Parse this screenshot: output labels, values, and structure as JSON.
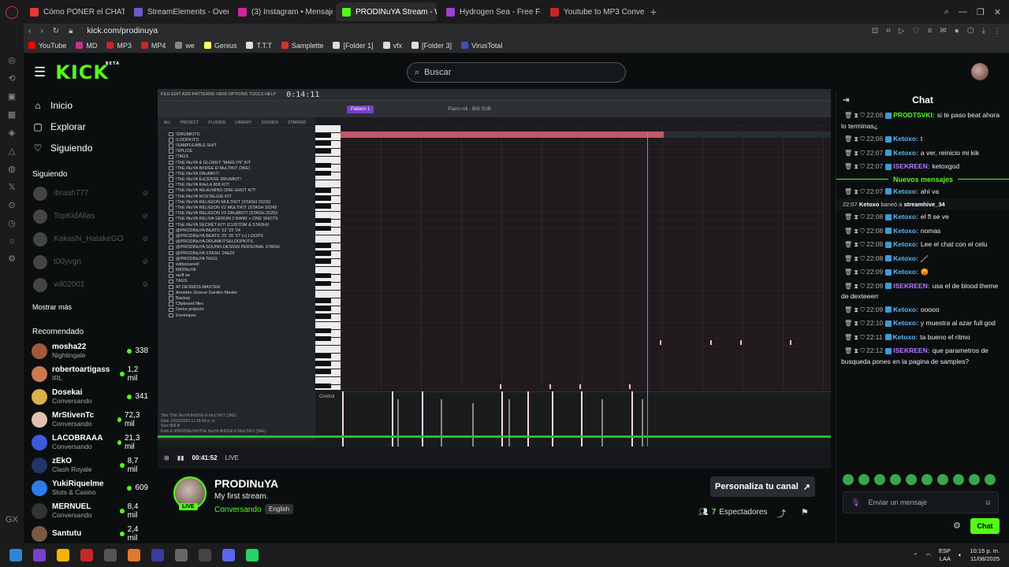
{
  "browser_tabs": [
    {
      "label": "Cómo PONER el CHAT de",
      "color": "#e53935",
      "active": false
    },
    {
      "label": "StreamElements - Overla",
      "color": "#6a5acd",
      "active": false
    },
    {
      "label": "(3) Instagram • Mensajes",
      "color": "#d6249f",
      "active": false
    },
    {
      "label": "PRODINuYA Stream - Wa",
      "color": "#53fc18",
      "active": true
    },
    {
      "label": "Hydrogen Sea - Free Falli",
      "color": "#a040d0",
      "active": false
    },
    {
      "label": "Youtube to MP3 Converte",
      "color": "#c62828",
      "active": false
    }
  ],
  "address": {
    "url": "kick.com/prodinuya"
  },
  "bookmarks": [
    {
      "label": "YouTube",
      "color": "#ff0000"
    },
    {
      "label": "MD",
      "color": "#c13584"
    },
    {
      "label": "MP3",
      "color": "#c62828"
    },
    {
      "label": "MP4",
      "color": "#c62828"
    },
    {
      "label": "we",
      "color": "#888888"
    },
    {
      "label": "Genius",
      "color": "#ffff64"
    },
    {
      "label": "T.T.T",
      "color": "#dddddd"
    },
    {
      "label": "Samplette",
      "color": "#cc3333"
    },
    {
      "label": "[Folder 1]",
      "color": "#dddddd"
    },
    {
      "label": "vfx",
      "color": "#dddddd"
    },
    {
      "label": "[Folder 3]",
      "color": "#dddddd"
    },
    {
      "label": "VirusTotal",
      "color": "#3f51b5"
    }
  ],
  "header": {
    "search_placeholder": "Buscar"
  },
  "sidebar": {
    "nav": [
      {
        "label": "Inicio",
        "icon": "home-icon"
      },
      {
        "label": "Explorar",
        "icon": "compass-icon"
      },
      {
        "label": "Siguiendo",
        "icon": "heart-icon"
      }
    ],
    "following_title": "Siguiendo",
    "following": [
      "ibraah777",
      "TopKidAlias",
      "Kakashi_HatakeGO",
      "t00yvgn",
      "wil02001"
    ],
    "more_label": "Mostrar más",
    "recommended_title": "Recomendado",
    "recommended": [
      {
        "name": "mosha22",
        "category": "Nightingale",
        "viewers": "338",
        "color": "#a05a3c"
      },
      {
        "name": "robertoartigass",
        "category": "IRL",
        "viewers": "1,2 mil",
        "color": "#c97a50"
      },
      {
        "name": "Dosekai",
        "category": "Conversando",
        "viewers": "341",
        "color": "#d9b24c"
      },
      {
        "name": "MrStivenTc",
        "category": "Conversando",
        "viewers": "72,3 mil",
        "color": "#e0c0b0"
      },
      {
        "name": "LACOBRAAA",
        "category": "Conversando",
        "viewers": "21,3 mil",
        "color": "#3b5bdb"
      },
      {
        "name": "zEkO",
        "category": "Clash Royale",
        "viewers": "8,7 mil",
        "color": "#223366"
      },
      {
        "name": "YukiRiquelme",
        "category": "Slots & Casino",
        "viewers": "609",
        "color": "#2b7de9"
      },
      {
        "name": "MERNUEL",
        "category": "Conversando",
        "viewers": "8,4 mil",
        "color": "#333333"
      },
      {
        "name": "Santutu",
        "category": "",
        "viewers": "2,4 mil",
        "color": "#7a5a40"
      }
    ]
  },
  "player": {
    "time": "0:14:11",
    "menu": "FILE EDIT ADD PATTERNS VIEW OPTIONS TOOLS HELP",
    "pattern": "Pattern 1",
    "roll_title": "Piano roll - 808 SUB",
    "control_label": "Control",
    "browser_tabs": [
      "ALL",
      "PROJECT",
      "PLUGINS",
      "LIBRARY",
      "SOUNDS",
      "STARRED"
    ],
    "browser_items": [
      "!DRUMKITS",
      "!LOOPKITS",
      "!SAMPLEABLE SHIT",
      "!SPLICE",
      "!TAGS",
      "!ThE iNuYA & GLOKEY \"MARLYN\" KIT",
      "!ThE iNuYA BrIDGE Ð MuLTiKiT (3KE)",
      "!ThE iNuYA DRuMKIT!",
      "!ThE iNuYA EsCENSE DRUMKIT!",
      "!ThE iNuYA KAvLA 808 KIT!",
      "!ThE iNuYA NEvErMIND ONE-SHOT KIT!",
      "!ThE iNuYA NOSTALGIE KIT",
      "!ThE iNuYA RELIGION MULTIKIT (STASH 2023)!",
      "!ThE iNuYA RELIGION V2 MULTIKIT (STASH 2024)!",
      "!ThE iNuYA RELIGION V3 DRuMKIT! (STASH 2025)!",
      "!ThE iNuYA RELIVA SERUM 2 BANK + ONE SHOTS",
      "!ThE iNuYA SECRET KIT! (CUSTOM & STASH)!",
      "@PRODINuYA BEATS '22 '23 '24",
      "@PRODINuYA BEATS '25 '26 '27 (+) LOOPS",
      "@PRODINuYA DRUMKITS&LOOPKITS",
      "@PRODINuYA SOUND-DESIGN PERSONAL STASH",
      "@PRODINuYA STASH '24&25",
      "@PRODINuYA TAGS",
      "eddyscared!",
      "MIDINuYA",
      "stuff ne",
      "TAGS",
      "AT DESMOS MASTER",
      "Aresden Groove Garden Master",
      "Backup",
      "Clipboard files",
      "Demo projects",
      "Envelopes"
    ],
    "file_info": [
      "Title   !ThE iNuYA BrIDGE Ð MuLTiKiT (3KE)",
      "Date    12/02/2023 11:18:48 p. m.",
      "Size    856 B",
      "Path    E:\\PRODINuYA\\!ThE iNuYA BrIDGE Ð MuLTiKiT (3KE)"
    ],
    "os_time": "00:41:52",
    "os_live": "LIVE"
  },
  "channel": {
    "name": "PRODINuYA",
    "title": "My first stream.",
    "category": "Conversando",
    "language": "English",
    "live_label": "LIVE",
    "customize_label": "Personaliza tu canal",
    "viewers_count": "7",
    "viewers_label": "Espectadores"
  },
  "chat": {
    "title": "Chat",
    "new_messages_label": "Nuevos mensajes",
    "messages_before": [
      {
        "time": "22:06",
        "user": "PRODTSVKI",
        "color": "#53fc18",
        "text": "si te paso beat ahora lo terminas¿"
      },
      {
        "time": "22:06",
        "user": "Ketoxo",
        "color": "#5db8f0",
        "text": "t"
      },
      {
        "time": "22:07",
        "user": "Ketoxo",
        "color": "#5db8f0",
        "text": "a ver, reinicio mi kik"
      },
      {
        "time": "22:07",
        "user": "ISEKREEN",
        "color": "#b37bff",
        "text": "ketoxgod"
      }
    ],
    "messages_after": [
      {
        "time": "22:07",
        "user": "Ketoxo",
        "color": "#5db8f0",
        "text": "ahí va"
      }
    ],
    "system": {
      "time": "22:07",
      "user": "Ketoxo",
      "action": "baneó a",
      "target": "streamhive_34"
    },
    "messages_tail": [
      {
        "time": "22:08",
        "user": "Ketoxo",
        "color": "#5db8f0",
        "text": "el fl se ve"
      },
      {
        "time": "22:08",
        "user": "Ketoxo",
        "color": "#5db8f0",
        "text": "nomas"
      },
      {
        "time": "22:08",
        "user": "Ketoxo",
        "color": "#5db8f0",
        "text": "Lee el chat con el celu"
      },
      {
        "time": "22:08",
        "user": "Ketoxo",
        "color": "#5db8f0",
        "text": "🦯"
      },
      {
        "time": "22:09",
        "user": "Ketoxo",
        "color": "#5db8f0",
        "text": "😡"
      },
      {
        "time": "22:09",
        "user": "ISEKREEN",
        "color": "#b37bff",
        "text": "usa el de blood theme de dexteeerr"
      },
      {
        "time": "22:09",
        "user": "Ketoxo",
        "color": "#5db8f0",
        "text": "ooooo"
      },
      {
        "time": "22:10",
        "user": "Ketoxo",
        "color": "#5db8f0",
        "text": "y muestra al azar full god"
      },
      {
        "time": "22:11",
        "user": "Ketoxo",
        "color": "#5db8f0",
        "text": "ta bueno el ritmo"
      },
      {
        "time": "22:12",
        "user": "ISEKREEN",
        "color": "#b37bff",
        "text": "que parametros de busqueda pones en la pagina de samples?"
      }
    ],
    "input_placeholder": "Enviar un mensaje",
    "send_label": "Chat"
  },
  "taskbar": {
    "lang": "ESP",
    "lang_sub": "LAA",
    "time": "10:15 p. m.",
    "date": "11/08/2025"
  }
}
